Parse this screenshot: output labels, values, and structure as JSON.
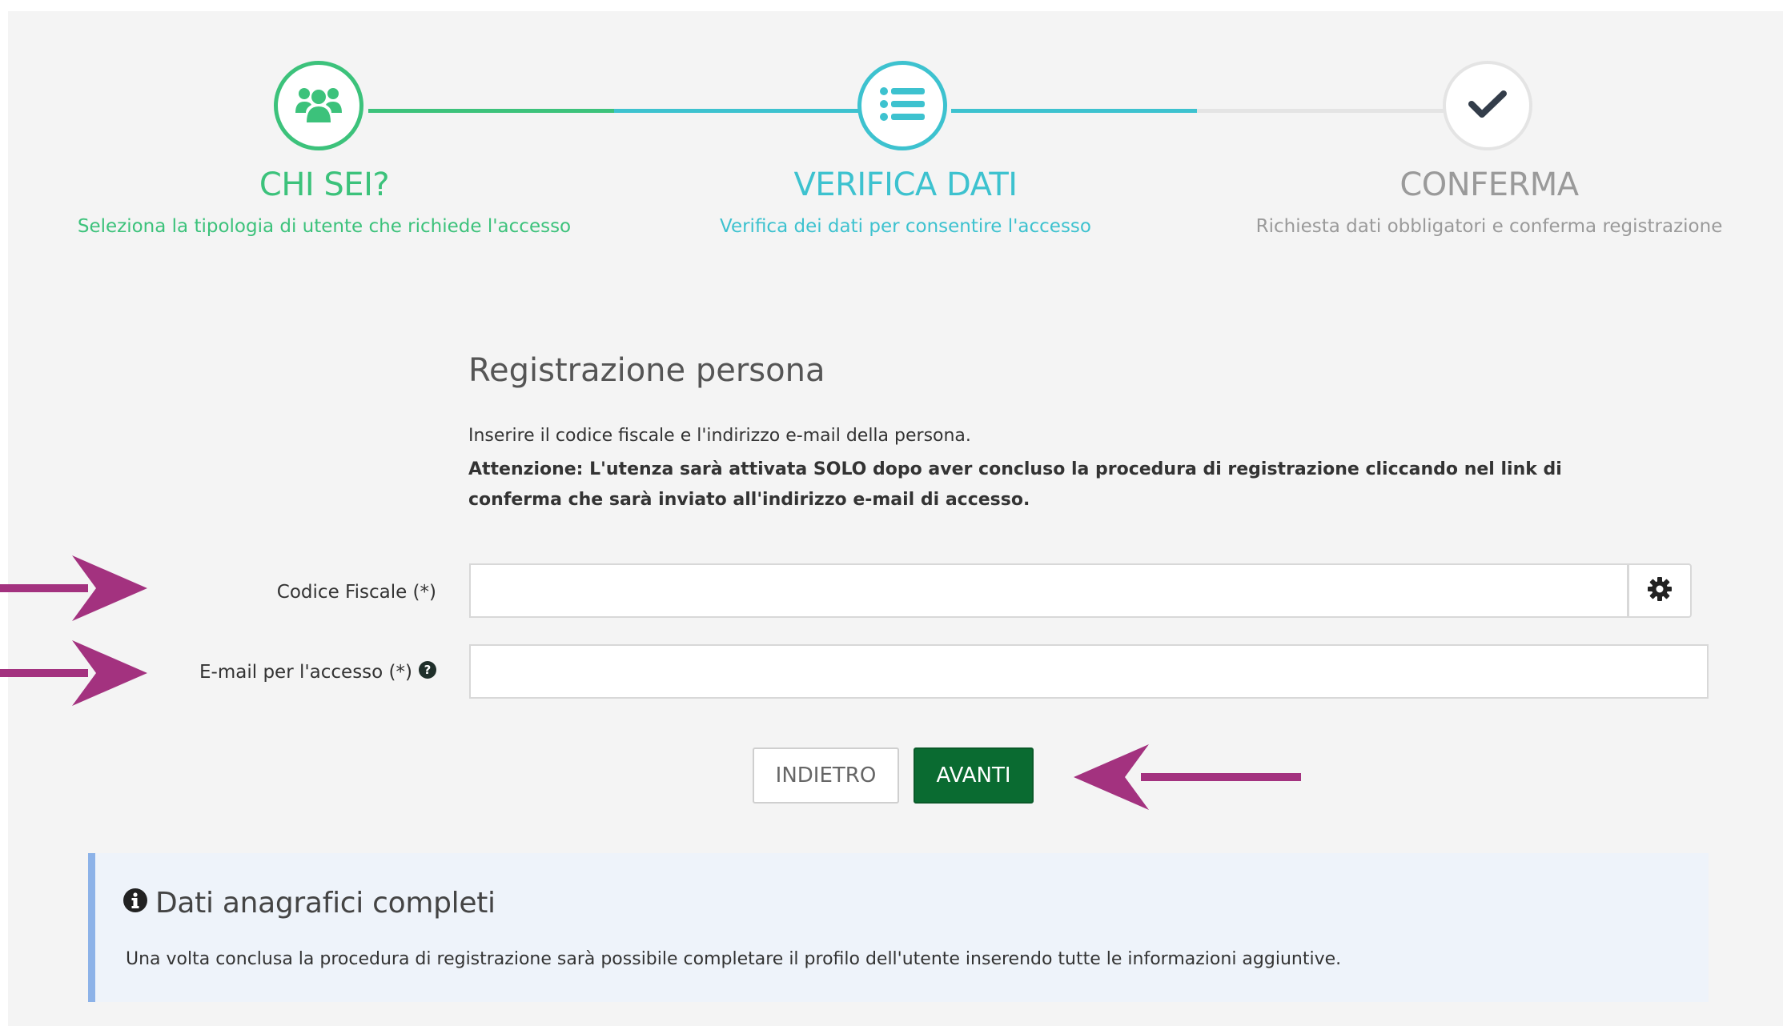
{
  "stepper": {
    "steps": [
      {
        "title": "CHI SEI?",
        "subtitle": "Seleziona la tipologia di utente che richiede l'accesso",
        "icon": "users-icon",
        "state": "completed",
        "color": "#3cc27b"
      },
      {
        "title": "VERIFICA DATI",
        "subtitle": "Verifica dei dati per consentire l'accesso",
        "icon": "list-icon",
        "state": "active",
        "color": "#3dc2cf"
      },
      {
        "title": "CONFERMA",
        "subtitle": "Richiesta dati obbligatori e conferma registrazione",
        "icon": "check-icon",
        "state": "pending",
        "color": "#9a9a9a"
      }
    ]
  },
  "form": {
    "title": "Registrazione persona",
    "description": "Inserire il codice fiscale e l'indirizzo e-mail della persona.",
    "warning": "Attenzione: L'utenza sarà attivata SOLO dopo aver concluso la procedura di registrazione cliccando nel link di conferma che sarà inviato all'indirizzo e-mail di accesso.",
    "fields": [
      {
        "label": "Codice Fiscale (*)",
        "value": "",
        "placeholder": "",
        "addon_icon": "gear-icon"
      },
      {
        "label": "E-mail per l'accesso (*)",
        "value": "",
        "placeholder": "",
        "help_icon": "question-circle-icon"
      }
    ],
    "buttons": {
      "back": "INDIETRO",
      "next": "AVANTI"
    }
  },
  "info": {
    "icon": "info-circle-icon",
    "title": "Dati anagrafici completi",
    "text": "Una volta conclusa la procedura di registrazione sarà possibile completare il profilo dell'utente inserendo tutte le informazioni aggiuntive."
  },
  "colors": {
    "step_completed": "#3cc27b",
    "step_active": "#3dc2cf",
    "primary_button": "#0a6b31",
    "annotation_arrow": "#a3327f",
    "info_border": "#8cb2e8"
  }
}
